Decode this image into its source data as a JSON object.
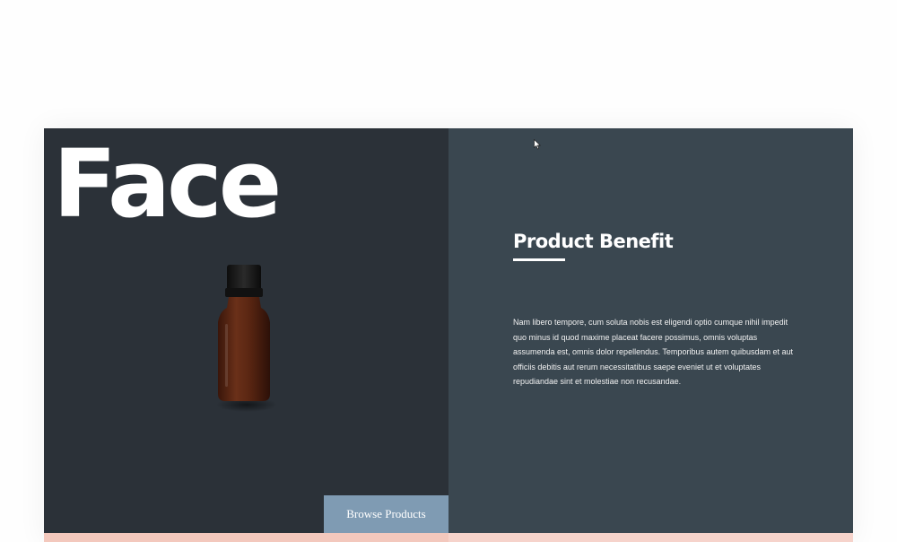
{
  "hero": {
    "title": "Face",
    "browse_button": "Browse Products"
  },
  "benefit": {
    "title": "Product Benefit",
    "body": "Nam libero tempore, cum soluta nobis est eligendi optio cumque nihil impedit quo minus id quod maxime placeat facere possimus, omnis voluptas assumenda est, omnis dolor repellendus. Temporibus autem quibusdam et aut officiis debitis aut rerum necessitatibus saepe eveniet ut et voluptates repudiandae sint et molestiae non recusandae."
  },
  "colors": {
    "left_panel": "#2b3138",
    "right_panel": "#3a4750",
    "button": "#7f9bb3",
    "accent_strip": "#f3c8bd",
    "bottle": "#5a2a16"
  },
  "icons": {
    "product": "serum-bottle-image",
    "pointer": "mouse-cursor-icon"
  }
}
